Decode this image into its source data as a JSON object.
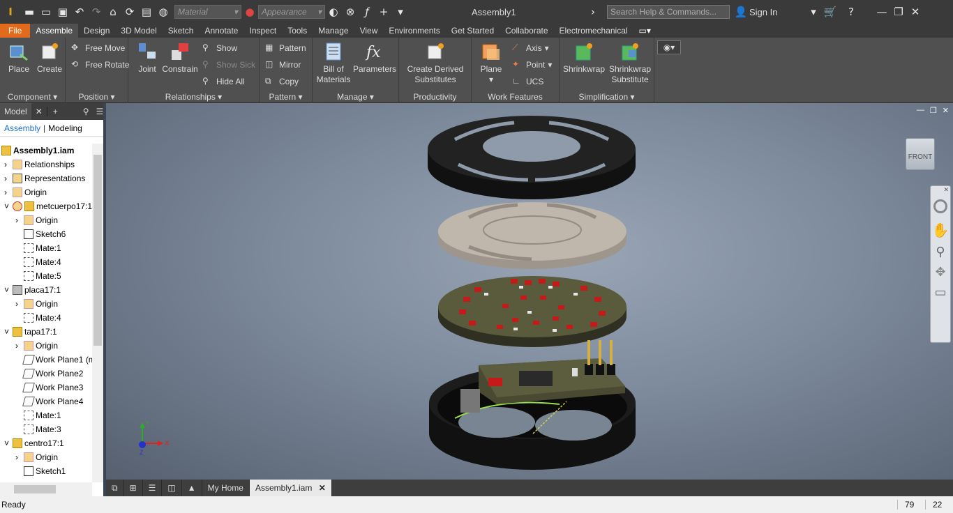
{
  "window": {
    "title": "Assembly1",
    "sign_in": "Sign In"
  },
  "quick_access": {
    "material_placeholder": "Material",
    "appearance_placeholder": "Appearance"
  },
  "search": {
    "placeholder": "Search Help & Commands..."
  },
  "tabs": [
    "File",
    "Assemble",
    "Design",
    "3D Model",
    "Sketch",
    "Annotate",
    "Inspect",
    "Tools",
    "Manage",
    "View",
    "Environments",
    "Get Started",
    "Collaborate",
    "Electromechanical"
  ],
  "ribbon": {
    "component": {
      "label": "Component",
      "place": "Place",
      "create": "Create"
    },
    "position": {
      "label": "Position",
      "free_move": "Free Move",
      "free_rotate": "Free Rotate"
    },
    "relationships": {
      "label": "Relationships",
      "joint": "Joint",
      "constrain": "Constrain",
      "show": "Show",
      "show_sick": "Show Sick",
      "hide_all": "Hide All"
    },
    "pattern": {
      "label": "Pattern",
      "pattern": "Pattern",
      "mirror": "Mirror",
      "copy": "Copy"
    },
    "manage": {
      "label": "Manage",
      "bom_line1": "Bill of",
      "bom_line2": "Materials",
      "parameters": "Parameters"
    },
    "productivity": {
      "label": "Productivity",
      "cds_line1": "Create Derived",
      "cds_line2": "Substitutes"
    },
    "work_features": {
      "label": "Work Features",
      "plane": "Plane",
      "axis": "Axis",
      "point": "Point",
      "ucs": "UCS"
    },
    "simplification": {
      "label": "Simplification",
      "shrinkwrap": "Shrinkwrap",
      "sws_line1": "Shrinkwrap",
      "sws_line2": "Substitute"
    }
  },
  "browser": {
    "header": "Model",
    "mode_assembly": "Assembly",
    "mode_modeling": "Modeling",
    "nodes": [
      {
        "label": "Assembly1.iam",
        "bold": true
      },
      {
        "label": "Relationships"
      },
      {
        "label": "Representations"
      },
      {
        "label": "Origin"
      },
      {
        "label": "metcuerpo17:1"
      },
      {
        "label": "Origin"
      },
      {
        "label": "Sketch6"
      },
      {
        "label": "Mate:1"
      },
      {
        "label": "Mate:4"
      },
      {
        "label": "Mate:5"
      },
      {
        "label": "placa17:1"
      },
      {
        "label": "Origin"
      },
      {
        "label": "Mate:4"
      },
      {
        "label": "tapa17:1"
      },
      {
        "label": "Origin"
      },
      {
        "label": "Work Plane1 (m"
      },
      {
        "label": "Work Plane2"
      },
      {
        "label": "Work Plane3"
      },
      {
        "label": "Work Plane4"
      },
      {
        "label": "Mate:1"
      },
      {
        "label": "Mate:3"
      },
      {
        "label": "centro17:1"
      },
      {
        "label": "Origin"
      },
      {
        "label": "Sketch1"
      }
    ]
  },
  "viewcube": {
    "face": "FRONT"
  },
  "triad": {
    "x": "X",
    "y": "Y",
    "z": "Z"
  },
  "doc_tabs": {
    "home": "My Home",
    "active": "Assembly1.iam"
  },
  "status": {
    "text": "Ready",
    "count1": "79",
    "count2": "22"
  },
  "colors": {
    "file_tab": "#e26a1c",
    "ribbon": "#505050",
    "viewport_bg": "#7d8a9c",
    "pcb": "#4a4a32",
    "red_comp": "#c41a1a"
  }
}
